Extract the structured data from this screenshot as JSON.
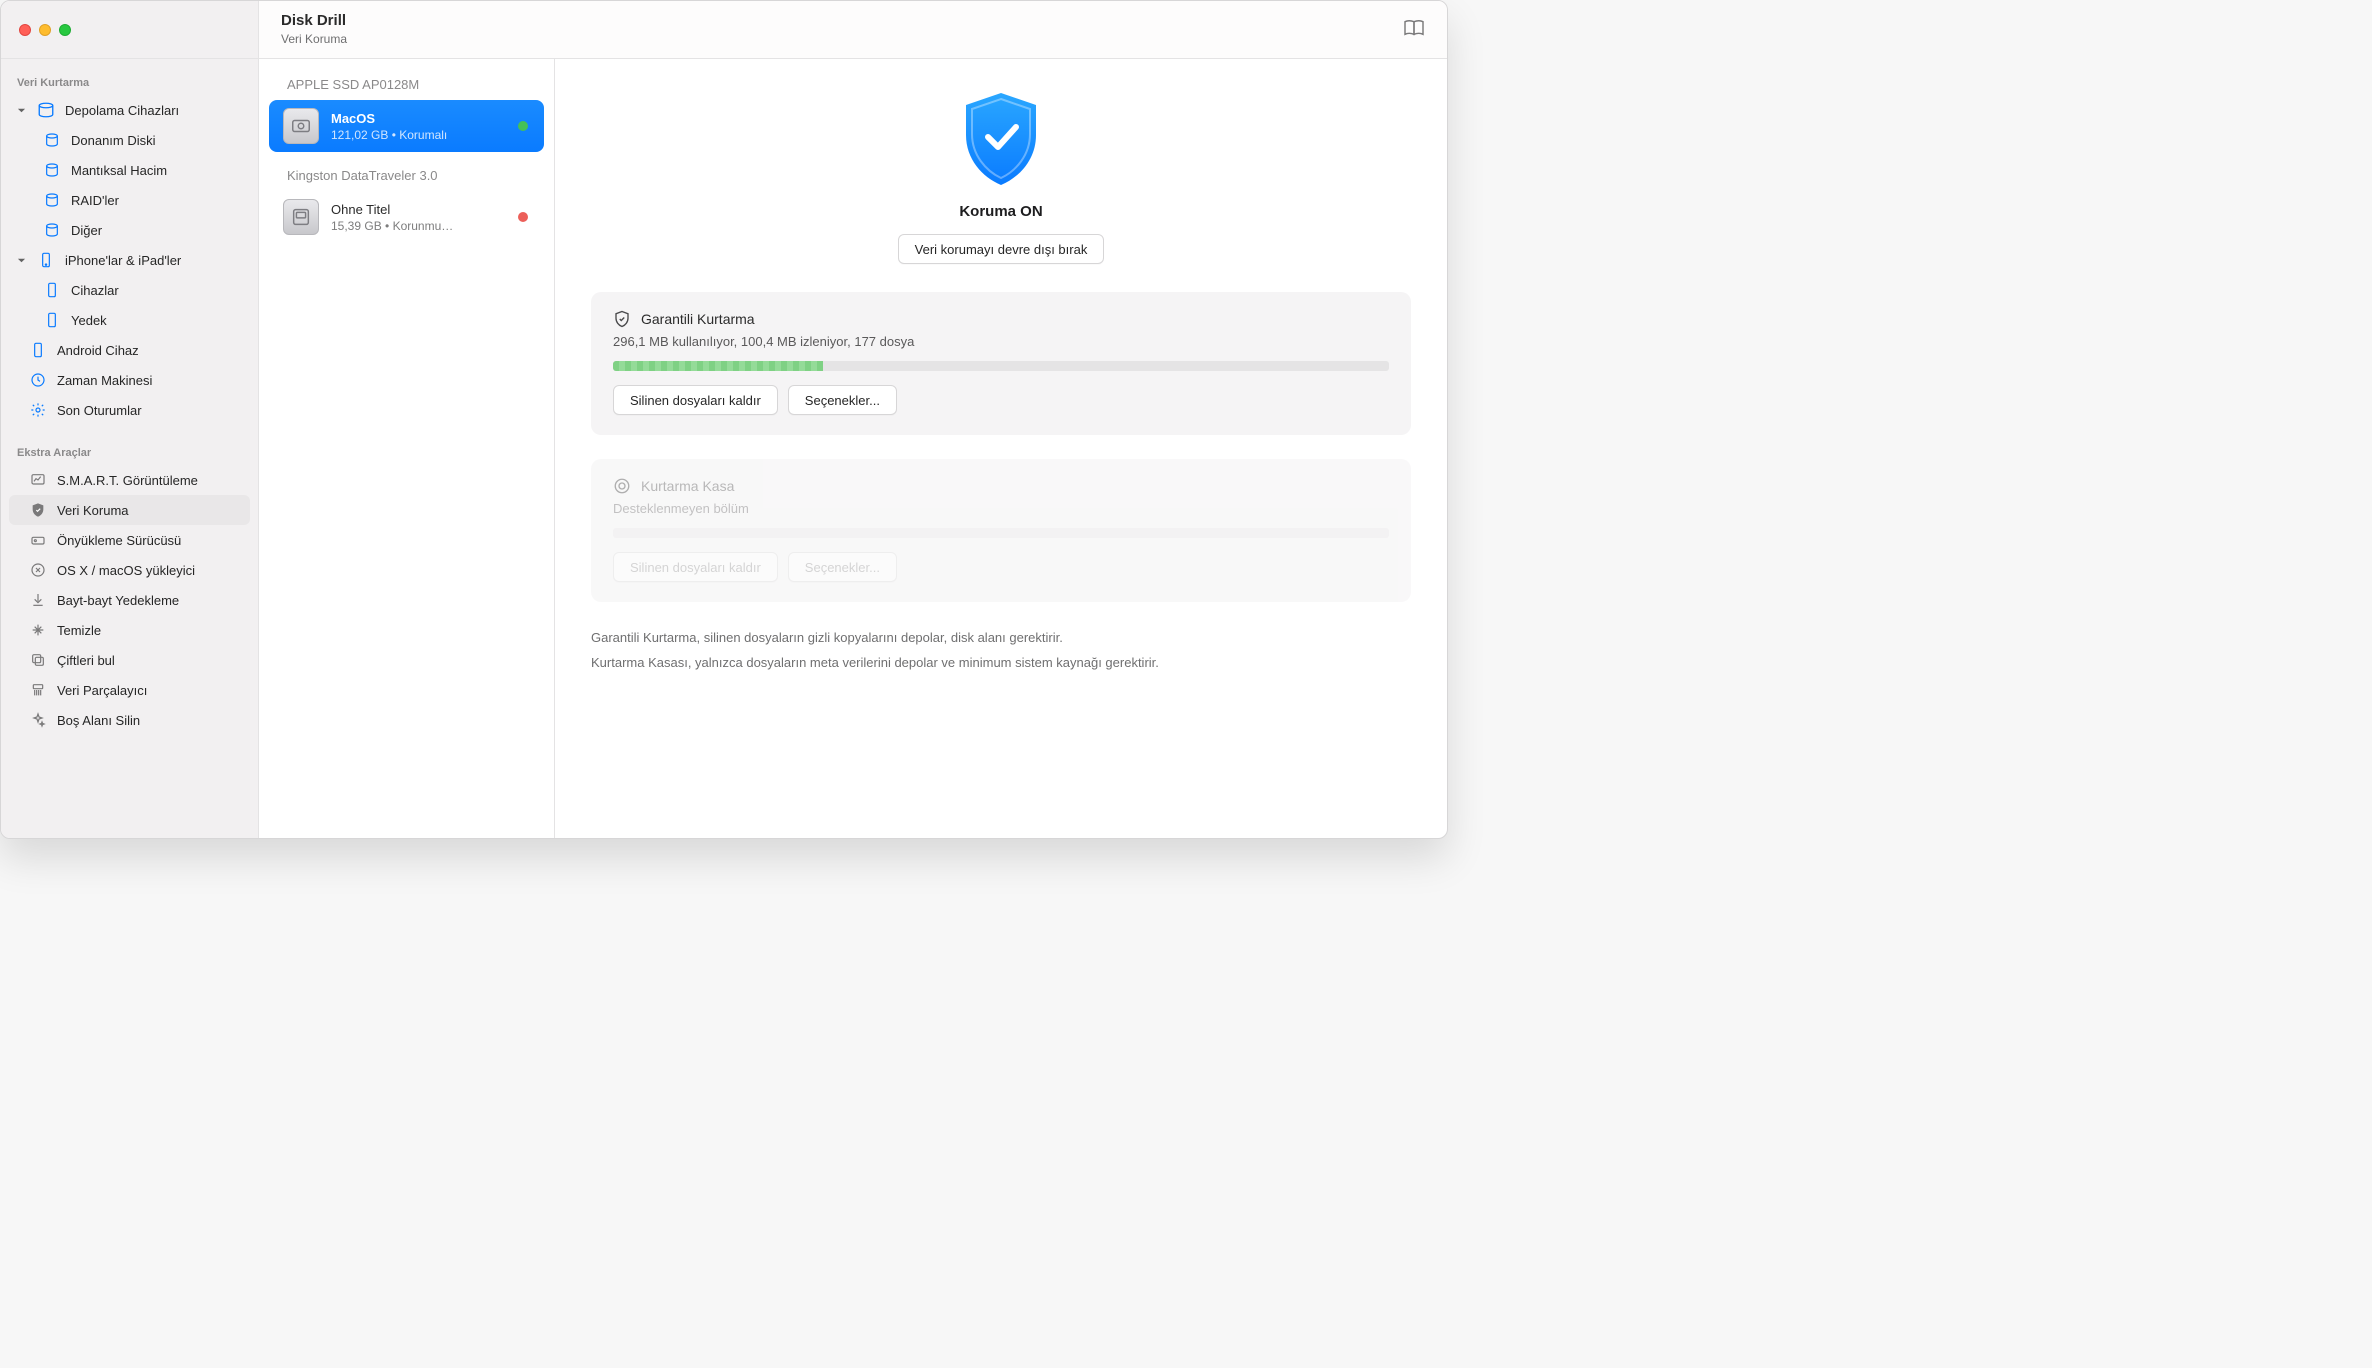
{
  "app": {
    "title": "Disk Drill",
    "subtitle": "Veri Koruma"
  },
  "sidebar": {
    "section1_label": "Veri Kurtarma",
    "storage_parent": "Depolama Cihazları",
    "storage_items": [
      "Donanım Diski",
      "Mantıksal Hacim",
      "RAID'ler",
      "Diğer"
    ],
    "iphones_parent": "iPhone'lar & iPad'ler",
    "iphones_items": [
      "Cihazlar",
      "Yedek"
    ],
    "android": "Android Cihaz",
    "timemachine": "Zaman Makinesi",
    "sessions": "Son Oturumlar",
    "section2_label": "Ekstra Araçlar",
    "tools": [
      "S.M.A.R.T. Görüntüleme",
      "Veri Koruma",
      "Önyükleme Sürücüsü",
      "OS X / macOS yükleyici",
      "Bayt-bayt Yedekleme",
      "Temizle",
      "Çiftleri bul",
      "Veri Parçalayıcı",
      "Boş Alanı Silin"
    ],
    "selected_tool_index": 1
  },
  "devices": {
    "groups": [
      {
        "header": "APPLE SSD AP0128M",
        "volumes": [
          {
            "title": "MacOS",
            "sub": "121,02 GB • Korumalı",
            "status": "green",
            "selected": true
          }
        ]
      },
      {
        "header": "Kingston DataTraveler 3.0",
        "volumes": [
          {
            "title": "Ohne Titel",
            "sub": "15,39 GB • Korunmu…",
            "status": "red",
            "selected": false
          }
        ]
      }
    ]
  },
  "detail": {
    "hero_title": "Koruma ON",
    "hero_button": "Veri korumayı devre dışı bırak",
    "panel1": {
      "title": "Garantili Kurtarma",
      "sub": "296,1 MB kullanılıyor, 100,4 MB izleniyor, 177 dosya",
      "progress_pct": 27,
      "btn_remove": "Silinen dosyaları kaldır",
      "btn_options": "Seçenekler..."
    },
    "panel2": {
      "title": "Kurtarma Kasa",
      "sub": "Desteklenmeyen bölüm",
      "btn_remove": "Silinen dosyaları kaldır",
      "btn_options": "Seçenekler..."
    },
    "footnote1": "Garantili Kurtarma, silinen dosyaların gizli kopyalarını depolar, disk alanı gerektirir.",
    "footnote2": "Kurtarma Kasası, yalnızca dosyaların meta verilerini depolar ve minimum sistem kaynağı gerektirir."
  }
}
